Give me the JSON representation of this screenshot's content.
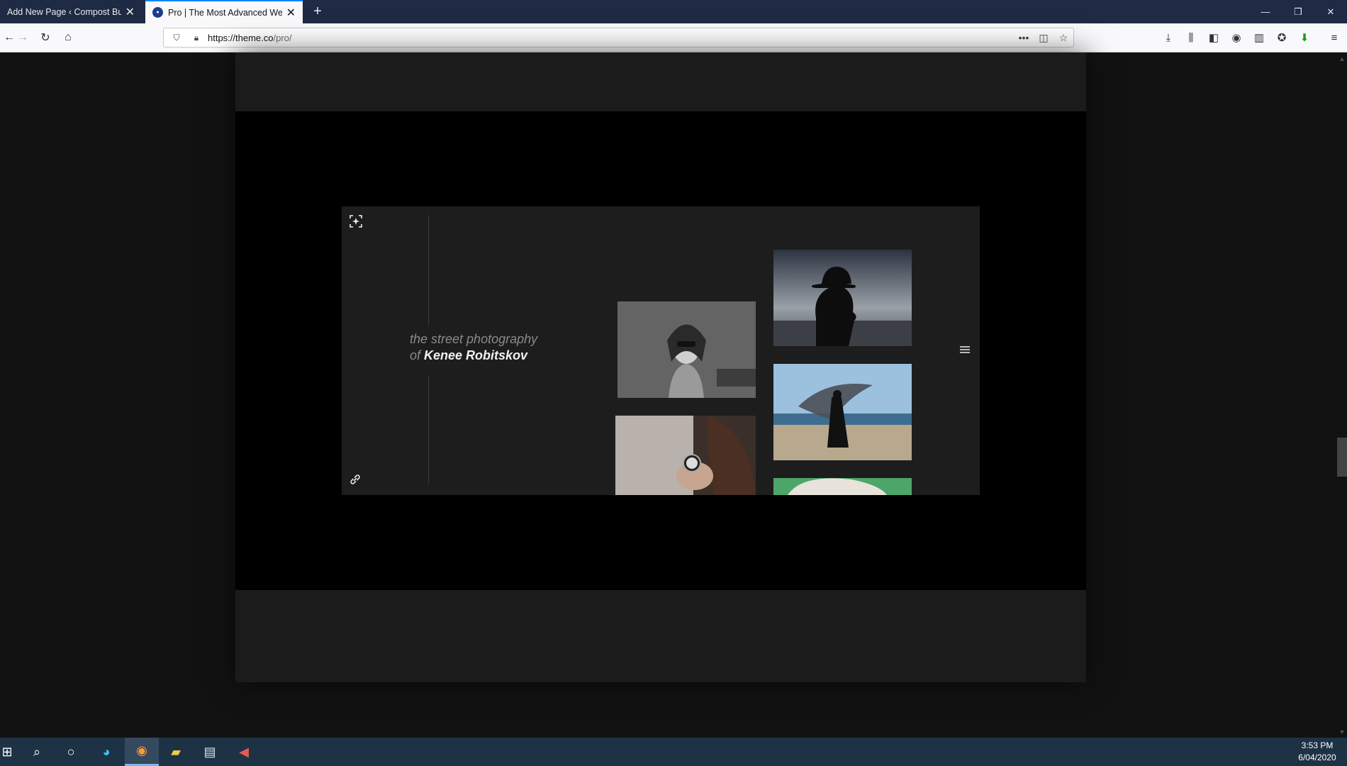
{
  "browser": {
    "tabs": [
      {
        "title": "Add New Page ‹ Compost Bud",
        "active": false
      },
      {
        "title": "Pro | The Most Advanced Webs",
        "active": true
      }
    ],
    "url_host": "https://theme.co",
    "url_path": "/pro/"
  },
  "demo": {
    "tagline_prefix": "the street photography",
    "tagline_of": "of",
    "photographer_name": "Kenee Robitskov"
  },
  "icons": {
    "fullscreen": "fullscreen-icon",
    "link": "link-icon",
    "menu": "hamburger-menu-icon"
  },
  "taskbar": {
    "time": "3:53 PM",
    "date": "6/04/2020"
  },
  "colors": {
    "tab_strip": "#1f2a44",
    "page_bg": "#121212",
    "stage_bg": "#000000",
    "taskbar": "#1e3246",
    "accent": "#0a84ff"
  }
}
